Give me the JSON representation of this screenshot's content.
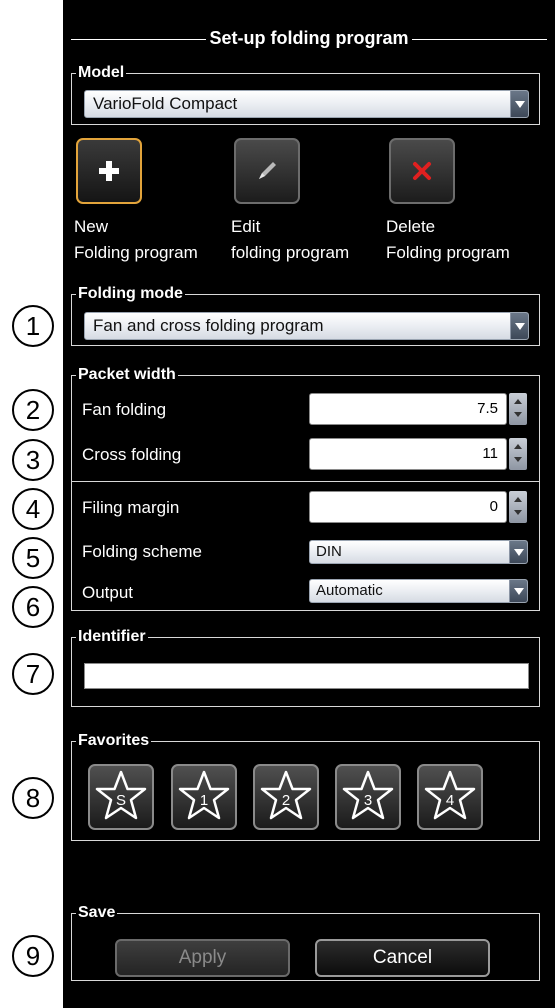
{
  "title": "Set-up folding program",
  "model": {
    "label": "Model",
    "selected": "VarioFold Compact"
  },
  "tools": [
    {
      "name": "new",
      "line1": "New",
      "line2": "Folding program",
      "icon": "plus-icon"
    },
    {
      "name": "edit",
      "line1": "Edit",
      "line2": "folding program",
      "icon": "pencil-icon"
    },
    {
      "name": "delete",
      "line1": "Delete",
      "line2": "Folding program",
      "icon": "x-icon"
    }
  ],
  "folding_mode": {
    "label": "Folding mode",
    "selected": "Fan and cross folding program"
  },
  "packet_width": {
    "label": "Packet width",
    "fan_label": "Fan folding",
    "fan_value": "7.5",
    "cross_label": "Cross folding",
    "cross_value": "11",
    "margin_label": "Filing margin",
    "margin_value": "0",
    "scheme_label": "Folding scheme",
    "scheme_value": "DIN",
    "output_label": "Output",
    "output_value": "Automatic"
  },
  "identifier": {
    "label": "Identifier",
    "value": ""
  },
  "favorites": {
    "label": "Favorites",
    "items": [
      "S",
      "1",
      "2",
      "3",
      "4"
    ]
  },
  "save": {
    "label": "Save",
    "apply": "Apply",
    "cancel": "Cancel"
  },
  "callouts": [
    "1",
    "2",
    "3",
    "4",
    "5",
    "6",
    "7",
    "8",
    "9"
  ],
  "colors": {
    "panel_bg": "#000000",
    "active_border": "#e3a43b",
    "delete_icon": "#e02020"
  }
}
